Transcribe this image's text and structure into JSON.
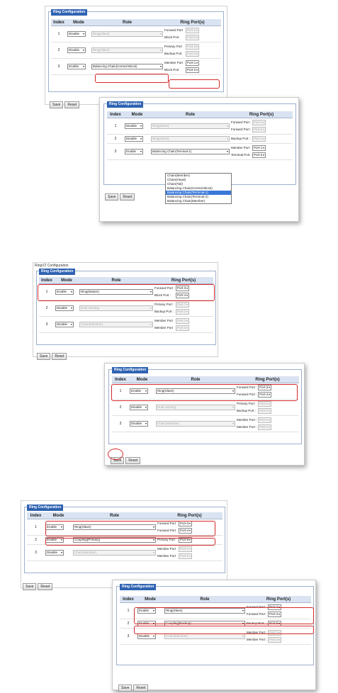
{
  "legend": "Ring Configuration",
  "ringv2_title": "RingV2 Configuration",
  "headers": {
    "index": "Index",
    "mode": "Mode",
    "role": "Role",
    "ports": "Ring Port(s)"
  },
  "buttons": {
    "save": "Save",
    "reset": "Reset"
  },
  "p1": {
    "rows": [
      {
        "index": "1",
        "mode": "Disable",
        "role": "Ring(Slave)",
        "port_labels": [
          "Forward Port",
          "Block Port"
        ],
        "port_values": [
          "Port-1",
          "Port-2"
        ]
      },
      {
        "index": "2",
        "mode": "Disable",
        "role": "Ring(Slave)",
        "port_labels": [
          "Primary Port",
          "Backup Port"
        ],
        "port_values": [
          "Port-3",
          "Port-4"
        ]
      },
      {
        "index": "3",
        "mode": "Enable",
        "role": "Balancing Chain(Central Block)",
        "port_labels": [
          "Member Port",
          "Block Port"
        ],
        "port_values": [
          "Port-1",
          "Port-2"
        ]
      }
    ]
  },
  "p2": {
    "rows": [
      {
        "index": "1",
        "mode": "Disable",
        "role": "Ring(Slave)",
        "port_labels": [
          "Forward Port :",
          "Forward Port :"
        ],
        "port_values": [
          "Port-1",
          "Port-2"
        ]
      },
      {
        "index": "2",
        "mode": "Disable",
        "role": "Ring(Slave)",
        "port_labels": [
          "Backup Port :"
        ],
        "port_values": [
          "Port-1"
        ]
      },
      {
        "index": "3",
        "mode": "Enable",
        "role": "Balancing Chain(Teminal-1)",
        "port_labels": [
          "Member Port :",
          "Terminal Port :"
        ],
        "port_values": [
          "Port-1",
          "Port-2"
        ]
      }
    ],
    "dropdown": [
      "Chain(Member)",
      "Chain(Head)",
      "Chain(Tail)",
      "Balancing Chain(Central Block)",
      "Balancing Chain(Terminal-1)",
      "Balancing Chain(Terminal-2)",
      "Balancing Chain(Member)"
    ],
    "dropdown_selected": 4
  },
  "p3": {
    "rows": [
      {
        "index": "1",
        "mode": "Enable",
        "role": "Ring(Master)",
        "port_labels": [
          "Forward Port :",
          "Block Port :"
        ],
        "port_values": [
          "Port-3",
          "Port-4"
        ]
      },
      {
        "index": "2",
        "mode": "Disable",
        "role": "Dual Homing",
        "port_labels": [
          "Primary Port :",
          "Backup Port :"
        ],
        "port_values": [
          "Port-7",
          "Port-2"
        ]
      },
      {
        "index": "3",
        "mode": "Disable",
        "role": "Chain(Member)",
        "port_labels": [
          "Member Port",
          "Member Port"
        ],
        "port_values": [
          "Port-1",
          "Port-2"
        ]
      }
    ]
  },
  "p4": {
    "rows": [
      {
        "index": "1",
        "mode": "Enable",
        "role": "Ring(Slave)",
        "port_labels": [
          "Forward Port :",
          "Forward Port :"
        ],
        "port_values": [
          "Port-3",
          "Port-4"
        ]
      },
      {
        "index": "2",
        "mode": "Disable",
        "role": "Dual Homing",
        "port_labels": [
          "Primary Port :",
          "Backup Port :"
        ],
        "port_values": [
          "Port-1",
          "Port-2"
        ]
      },
      {
        "index": "3",
        "mode": "Disable",
        "role": "Chain(Member)",
        "port_labels": [
          "Member Port :",
          "Member Port :"
        ],
        "port_values": [
          "Port-1",
          "Port-2"
        ]
      }
    ]
  },
  "p5": {
    "rows": [
      {
        "index": "1",
        "mode": "Enable",
        "role": "Ring(Slave)",
        "port_labels": [
          "Forward Port",
          "Forward Port"
        ],
        "port_values": [
          "Port-3",
          "Port-4"
        ]
      },
      {
        "index": "2",
        "mode": "Enable",
        "role": "Coupling(Primary)",
        "port_labels": [
          "Primary Port"
        ],
        "port_values": [
          "Port-6"
        ]
      },
      {
        "index": "3",
        "mode": "Disable",
        "role": "Chain(Member)",
        "port_labels": [
          "Member Port",
          "Member Port"
        ],
        "port_values": [
          "Port-1",
          "Port-2"
        ]
      }
    ]
  },
  "p6": {
    "rows": [
      {
        "index": "1",
        "mode": "Enable",
        "role": "Ring(Slave)",
        "port_labels": [
          "Forward Port :",
          "Forward Port :"
        ],
        "port_values": [
          "Port-3",
          "Port-4"
        ]
      },
      {
        "index": "2",
        "mode": "Enable",
        "role": "Coupling(Backup)",
        "port_labels": [
          "Backup Port :"
        ],
        "port_values": [
          "Port-5"
        ]
      },
      {
        "index": "3",
        "mode": "Disable",
        "role": "Chain(Member)",
        "port_labels": [
          "Member Port :",
          "Member Port :"
        ],
        "port_values": [
          "Port-1",
          "Port-2"
        ]
      }
    ]
  }
}
